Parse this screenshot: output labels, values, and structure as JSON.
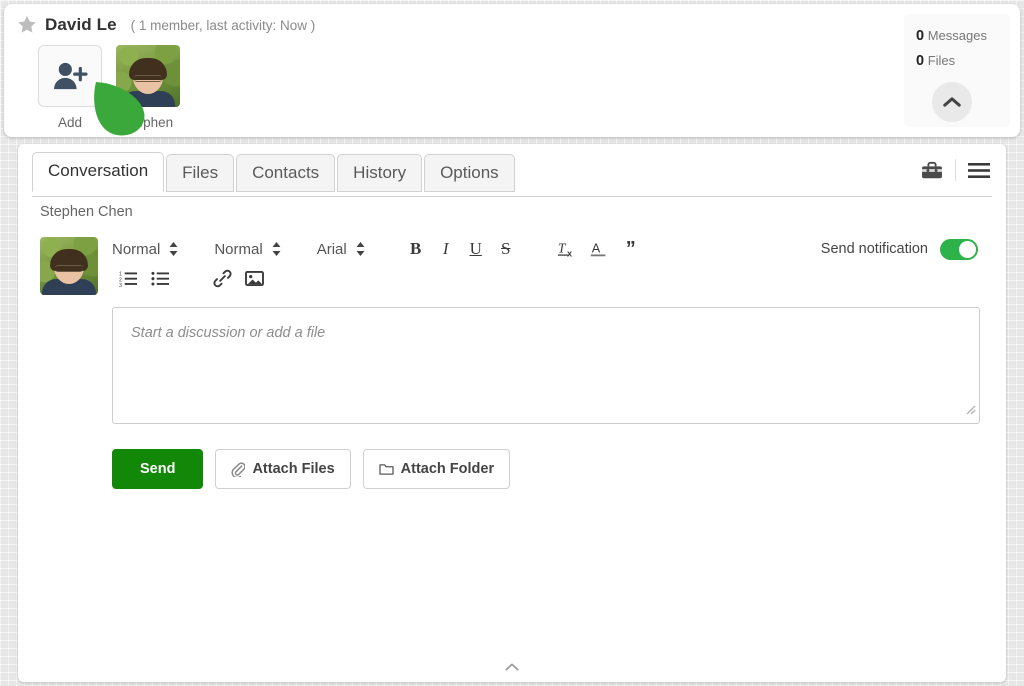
{
  "header": {
    "star_icon": "star-icon",
    "group_name": "David Le",
    "meta": "( 1 member, last activity: Now )",
    "members": [
      {
        "icon": "add-person-icon",
        "label": "Add"
      },
      {
        "icon": "avatar",
        "label": "Stephen"
      }
    ],
    "counts": {
      "messages_value": "0",
      "messages_label": "Messages",
      "files_value": "0",
      "files_label": "Files",
      "collapse_icon": "chevron-up-icon"
    }
  },
  "main": {
    "tabs": [
      {
        "label": "Conversation",
        "active": true
      },
      {
        "label": "Files",
        "active": false
      },
      {
        "label": "Contacts",
        "active": false
      },
      {
        "label": "History",
        "active": false
      },
      {
        "label": "Options",
        "active": false
      }
    ],
    "header_icons": [
      {
        "name": "toolbox-icon"
      },
      {
        "name": "hamburger-menu-icon"
      }
    ],
    "sender_name": "Stephen Chen"
  },
  "composer": {
    "avatar_name": "composer-avatar",
    "dropdowns": [
      {
        "name": "paragraph-style-select",
        "value": "Normal"
      },
      {
        "name": "font-size-select",
        "value": "Normal"
      },
      {
        "name": "font-family-select",
        "value": "Arial"
      }
    ],
    "format_buttons": [
      {
        "name": "bold-button",
        "label": "B"
      },
      {
        "name": "italic-button",
        "label": "I"
      },
      {
        "name": "underline-button",
        "label": "U"
      },
      {
        "name": "strikethrough-button",
        "label": "S"
      }
    ],
    "extra_buttons": [
      {
        "name": "clear-format-icon"
      },
      {
        "name": "text-color-icon"
      },
      {
        "name": "blockquote-icon",
        "label": "”"
      }
    ],
    "second_row_icons": [
      {
        "name": "ordered-list-icon"
      },
      {
        "name": "unordered-list-icon"
      },
      {
        "name": "link-icon"
      },
      {
        "name": "image-icon"
      }
    ],
    "notification": {
      "label": "Send notification",
      "state": "on"
    },
    "editor_placeholder": "Start a discussion or add a file",
    "actions": {
      "send_label": "Send",
      "attach_files_label": "Attach Files",
      "attach_folder_label": "Attach Folder"
    }
  },
  "footer": {
    "collapse_icon": "chevron-up-icon"
  },
  "colors": {
    "accent_green": "#138808",
    "toggle_green": "#2eb24a",
    "cursor_green": "#3aa83a",
    "page_bg": "#e7e7e7"
  }
}
